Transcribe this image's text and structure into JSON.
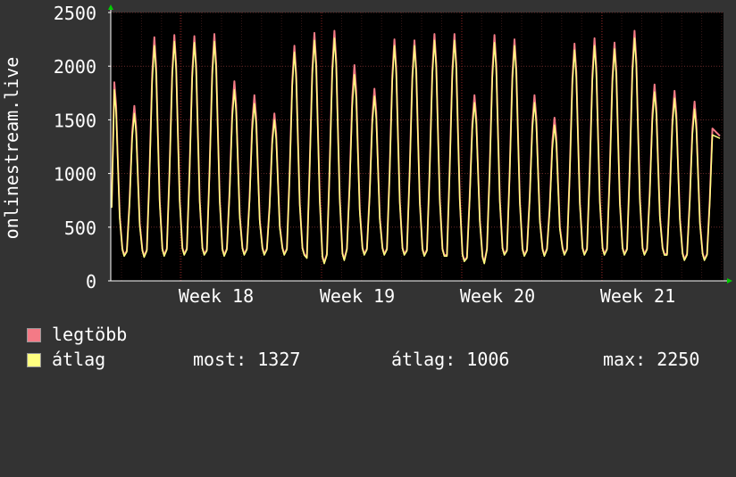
{
  "chart_data": {
    "type": "line",
    "ylabel": "onlinestream.live",
    "y_ticks": [
      0,
      500,
      1000,
      1500,
      2000,
      2500
    ],
    "ylim": [
      0,
      2500
    ],
    "x_ticks": [
      "Week 18",
      "Week 19",
      "Week 20",
      "Week 21"
    ],
    "grid": true,
    "colors": {
      "background": "#333333",
      "plot_area": "#000000",
      "grid": "#6a2a2a",
      "axis": "#ffffff",
      "arrow": "#00cc00",
      "max_series": "#f47a86",
      "avg_series": "#ffff80"
    },
    "series": [
      {
        "name": "legtöbb",
        "color": "#f47a86",
        "daily_peaks": [
          1850,
          1630,
          2270,
          2290,
          2280,
          2300,
          1860,
          1730,
          1560,
          2190,
          2310,
          2330,
          2010,
          1790,
          2250,
          2240,
          2300,
          2300,
          1730,
          2290,
          2250,
          1730,
          1520,
          2210,
          2260,
          2220,
          2330,
          1830,
          1770,
          1670
        ],
        "daily_troughs": [
          240,
          230,
          240,
          250,
          250,
          240,
          250,
          250,
          250,
          250,
          170,
          200,
          250,
          250,
          250,
          240,
          240,
          190,
          170,
          250,
          240,
          240,
          250,
          250,
          250,
          250,
          250,
          250,
          200,
          200
        ],
        "last": 1350
      },
      {
        "name": "átlag",
        "color": "#ffff80",
        "daily_peaks": [
          1780,
          1560,
          2190,
          2230,
          2220,
          2230,
          1780,
          1650,
          1500,
          2130,
          2240,
          2260,
          1920,
          1720,
          2190,
          2190,
          2240,
          2240,
          1660,
          2220,
          2190,
          1660,
          1450,
          2150,
          2190,
          2160,
          2260,
          1760,
          1700,
          1600
        ],
        "daily_troughs": [
          230,
          220,
          230,
          240,
          240,
          230,
          240,
          240,
          240,
          240,
          160,
          190,
          240,
          240,
          240,
          230,
          230,
          180,
          160,
          240,
          230,
          230,
          240,
          240,
          240,
          240,
          240,
          240,
          190,
          190
        ],
        "last": 1327
      }
    ]
  },
  "legend": {
    "items": [
      {
        "label": "legtöbb",
        "color": "#f47a86"
      },
      {
        "label": "átlag",
        "color": "#ffff80"
      }
    ],
    "stats": {
      "most": "most: 1327",
      "atlag": "átlag: 1006",
      "max": "max: 2250"
    }
  }
}
